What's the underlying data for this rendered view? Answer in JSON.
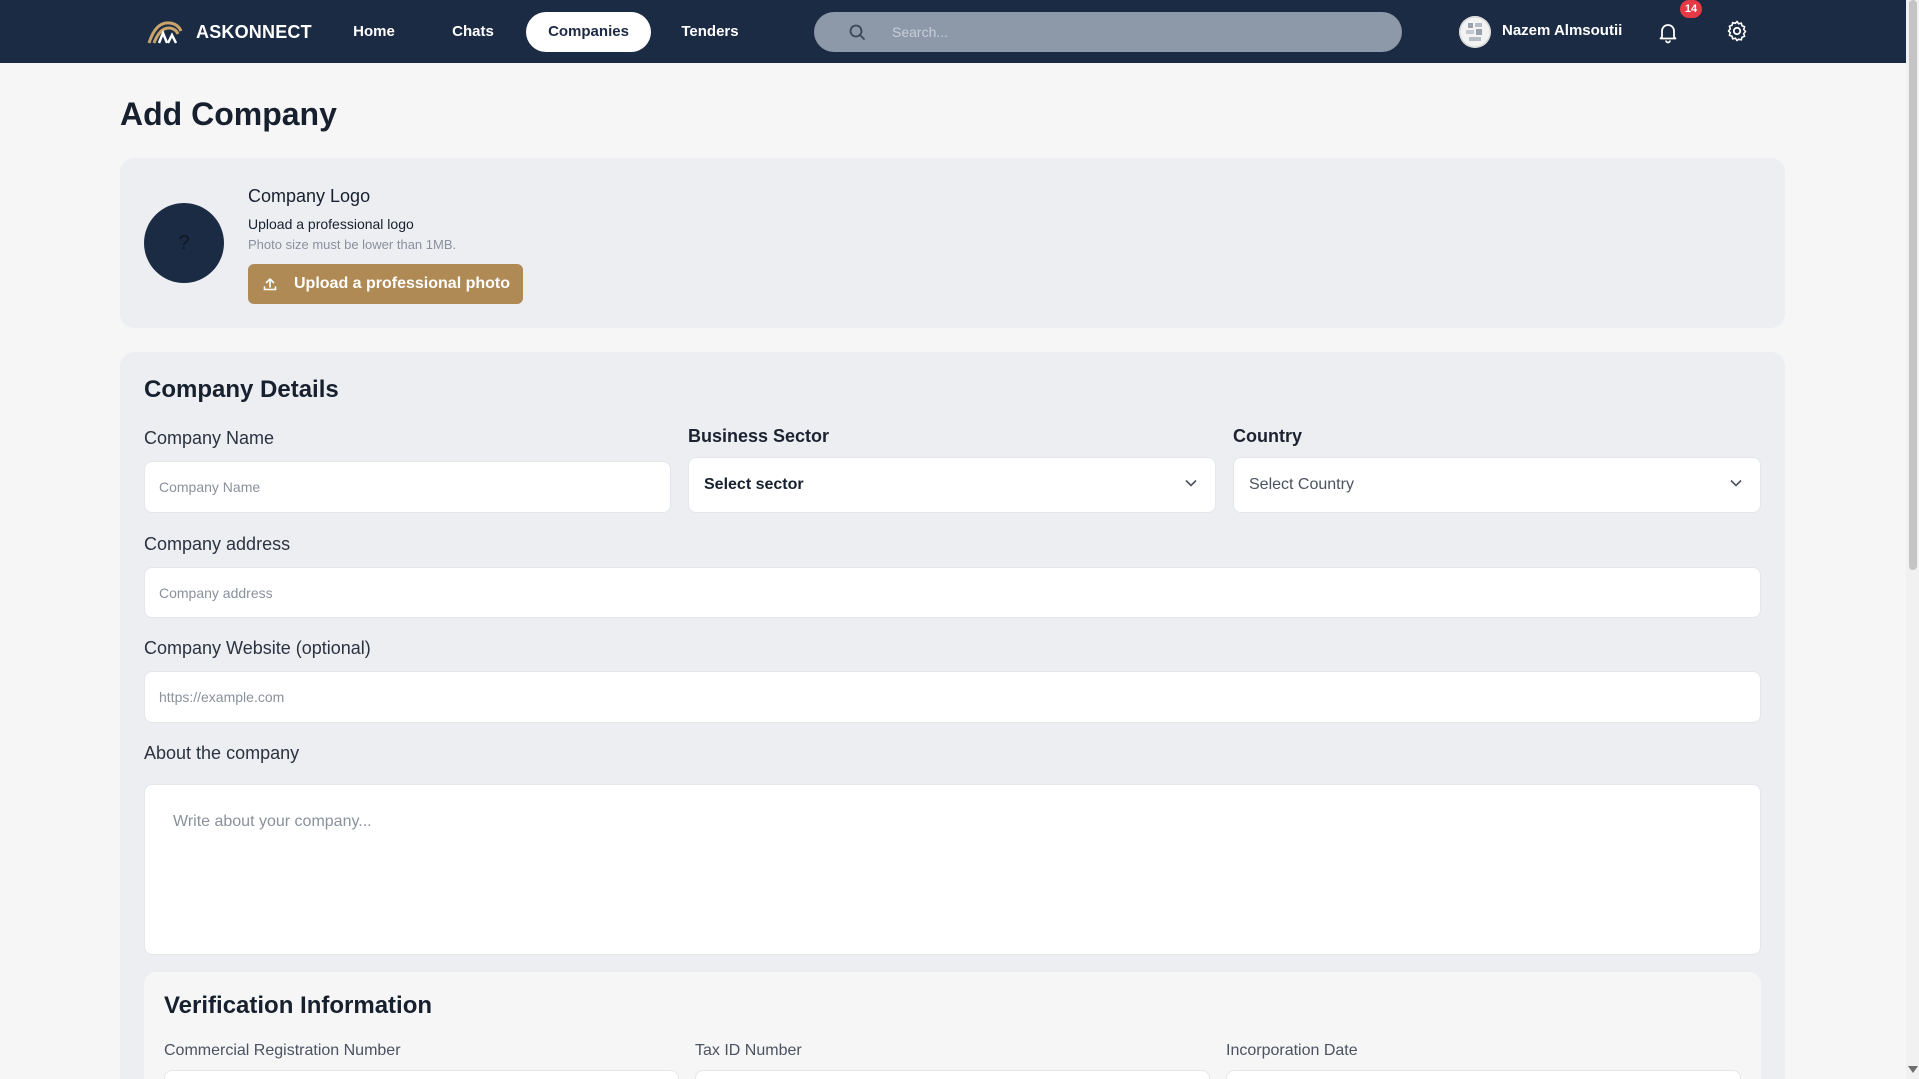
{
  "app": {
    "brand": "ASKONNECT",
    "nav": [
      {
        "label": "Home"
      },
      {
        "label": "Chats"
      },
      {
        "label": "Companies",
        "active": true
      },
      {
        "label": "Tenders"
      }
    ],
    "search_placeholder": "Search...",
    "user_name": "Nazem Almsoutii",
    "notification_count": "14"
  },
  "page": {
    "title": "Add Company",
    "logo_section": {
      "title": "Company Logo",
      "subtitle": "Upload a professional logo",
      "hint": "Photo size must be lower than 1MB.",
      "placeholder_symbol": "?",
      "upload_button": "Upload a professional photo"
    },
    "details": {
      "title": "Company Details",
      "company_name_label": "Company Name",
      "company_name_placeholder": "Company Name",
      "sector_label": "Business Sector",
      "sector_value": "Select sector",
      "country_label": "Country",
      "country_value": "Select Country",
      "address_label": "Company address",
      "address_placeholder": "Company address",
      "website_label": "Company Website (optional)",
      "website_placeholder": "https://example.com",
      "about_label": "About the company",
      "about_placeholder": "Write about your company..."
    },
    "verification": {
      "title": "Verification Information",
      "reg_label": "Commercial Registration Number",
      "tax_label": "Tax ID Number",
      "date_label": "Incorporation Date"
    }
  },
  "colors": {
    "nav_bg": "#1c2b44",
    "accent_gold": "#b08a55",
    "badge_red": "#e53945"
  }
}
